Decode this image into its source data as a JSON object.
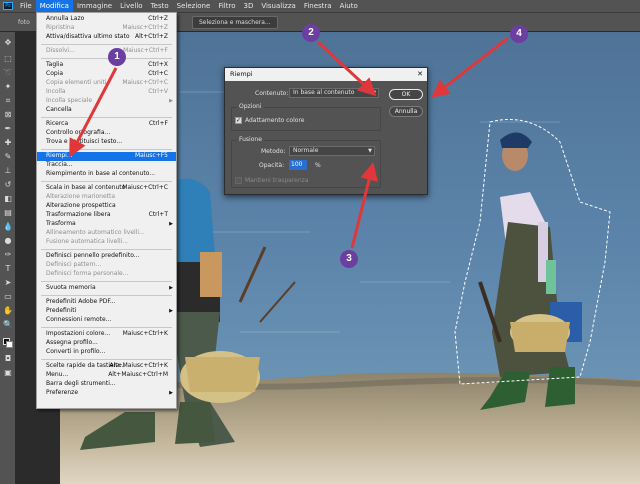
{
  "menubar": {
    "app_icon": "Ps",
    "items": [
      "File",
      "Modifica",
      "Immagine",
      "Livello",
      "Testo",
      "Selezione",
      "Filtro",
      "3D",
      "Visualizza",
      "Finestra",
      "Aiuto"
    ]
  },
  "options_bar": {
    "tab_stub": "foto",
    "mask_button": "Seleziona e maschera..."
  },
  "edit_menu": {
    "items": [
      {
        "label": "Annulla Lazo",
        "shortcut": "Ctrl+Z"
      },
      {
        "label": "Ripristina",
        "shortcut": "Maiusc+Ctrl+Z"
      },
      {
        "label": "Attiva/disattiva ultimo stato",
        "shortcut": "Alt+Ctrl+Z"
      },
      {
        "label": "Dissolvi...",
        "shortcut": "Maiusc+Ctrl+F"
      },
      {
        "label": "Taglia",
        "shortcut": "Ctrl+X"
      },
      {
        "label": "Copia",
        "shortcut": "Ctrl+C"
      },
      {
        "label": "Copia elementi uniti",
        "shortcut": "Maiusc+Ctrl+C"
      },
      {
        "label": "Incolla",
        "shortcut": "Ctrl+V"
      },
      {
        "label": "Incolla speciale"
      },
      {
        "label": "Cancella"
      },
      {
        "label": "Ricerca",
        "shortcut": "Ctrl+F"
      },
      {
        "label": "Controllo ortografia..."
      },
      {
        "label": "Trova e sostituisci testo..."
      },
      {
        "label": "Riempi...",
        "shortcut": "Maiusc+F5"
      },
      {
        "label": "Traccia..."
      },
      {
        "label": "Riempimento in base al contenuto..."
      },
      {
        "label": "Scala in base al contenuto",
        "shortcut": "Maiusc+Ctrl+C"
      },
      {
        "label": "Alterazione marionetta"
      },
      {
        "label": "Alterazione prospettica"
      },
      {
        "label": "Trasformazione libera",
        "shortcut": "Ctrl+T"
      },
      {
        "label": "Trasforma"
      },
      {
        "label": "Allineamento automatico livelli..."
      },
      {
        "label": "Fusione automatica livelli..."
      },
      {
        "label": "Definisci pennello predefinito..."
      },
      {
        "label": "Definisci pattern..."
      },
      {
        "label": "Definisci forma personale..."
      },
      {
        "label": "Svuota memoria"
      },
      {
        "label": "Predefiniti Adobe PDF..."
      },
      {
        "label": "Predefiniti"
      },
      {
        "label": "Connessioni remote..."
      },
      {
        "label": "Impostazioni colore...",
        "shortcut": "Maiusc+Ctrl+K"
      },
      {
        "label": "Assegna profilo..."
      },
      {
        "label": "Converti in profilo..."
      },
      {
        "label": "Scelte rapide da tastiera...",
        "shortcut": "Alt+Maiusc+Ctrl+K"
      },
      {
        "label": "Menu...",
        "shortcut": "Alt+Maiusc+Ctrl+M"
      },
      {
        "label": "Barra degli strumenti..."
      },
      {
        "label": "Preferenze"
      }
    ]
  },
  "fill_dialog": {
    "title": "Riempi",
    "close": "✕",
    "content_label": "Contenuto:",
    "content_value": "In base al contenuto",
    "options_group": "Opzioni",
    "color_adapt_label": "Adattamento colore",
    "color_adapt_checked": true,
    "blend_group": "Fusione",
    "mode_label": "Metodo:",
    "mode_value": "Normale",
    "opacity_label": "Opacità:",
    "opacity_value": "100",
    "opacity_unit": "%",
    "preserve_transparency_label": "Mantieni trasparenza",
    "ok_label": "OK",
    "cancel_label": "Annulla"
  },
  "annotations": {
    "badge_1": "1",
    "badge_2": "2",
    "badge_3": "3",
    "badge_4": "4",
    "color": "#e0383a",
    "badge_color": "#6b3fa0"
  }
}
